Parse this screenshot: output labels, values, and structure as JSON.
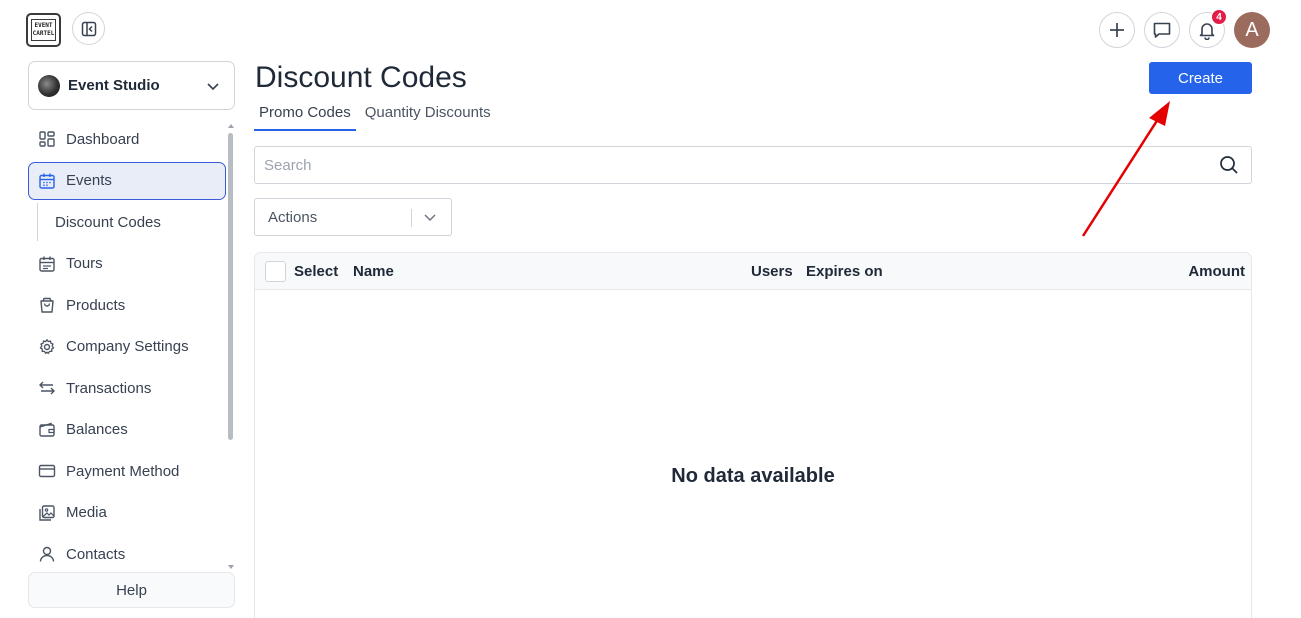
{
  "topbar": {
    "logo_line1": "EVENT",
    "logo_line2": "CARTEL",
    "notifications_count": "4",
    "avatar_initial": "A"
  },
  "sidebar": {
    "org_name": "Event Studio",
    "items": [
      {
        "label": "Dashboard",
        "icon": "dashboard-icon"
      },
      {
        "label": "Events",
        "icon": "calendar-icon",
        "active": true
      },
      {
        "label": "Discount Codes",
        "sub": true
      },
      {
        "label": "Tours",
        "icon": "calendar-icon"
      },
      {
        "label": "Products",
        "icon": "shopping-bag-icon"
      },
      {
        "label": "Company Settings",
        "icon": "gear-icon"
      },
      {
        "label": "Transactions",
        "icon": "arrows-swap-icon"
      },
      {
        "label": "Balances",
        "icon": "wallet-icon"
      },
      {
        "label": "Payment Method",
        "icon": "credit-card-icon"
      },
      {
        "label": "Media",
        "icon": "images-icon"
      },
      {
        "label": "Contacts",
        "icon": "user-icon"
      }
    ],
    "help_label": "Help"
  },
  "main": {
    "title": "Discount Codes",
    "create_label": "Create",
    "tabs": [
      {
        "label": "Promo Codes",
        "active": true
      },
      {
        "label": "Quantity Discounts",
        "active": false
      }
    ],
    "search_placeholder": "Search",
    "actions_label": "Actions",
    "table": {
      "columns": [
        "Select",
        "Name",
        "Users",
        "Expires on",
        "Amount"
      ],
      "empty_text": "No data available"
    }
  },
  "colors": {
    "accent": "#2563eb",
    "active_nav_bg": "#e8edf7",
    "badge": "#e11d48",
    "annotation_arrow": "#e50000"
  }
}
